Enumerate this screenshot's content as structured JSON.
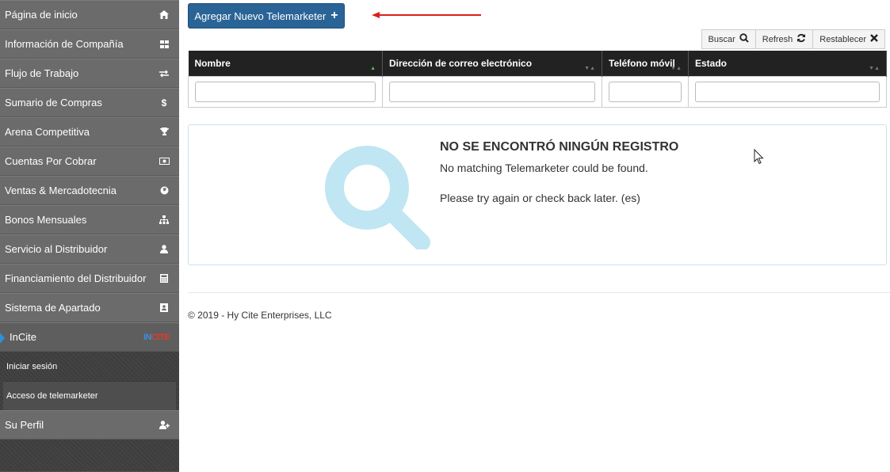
{
  "sidebar": {
    "items": [
      {
        "label": "Página de inicio",
        "icon": "home-icon"
      },
      {
        "label": "Información de Compañía",
        "icon": "grid-icon"
      },
      {
        "label": "Flujo de Trabajo",
        "icon": "exchange-icon"
      },
      {
        "label": "Sumario de Compras",
        "icon": "dollar-icon"
      },
      {
        "label": "Arena Competitiva",
        "icon": "trophy-icon"
      },
      {
        "label": "Cuentas Por Cobrar",
        "icon": "money-icon"
      },
      {
        "label": "Ventas & Mercadotecnia",
        "icon": "globe-icon"
      },
      {
        "label": "Bonos Mensuales",
        "icon": "sitemap-icon"
      },
      {
        "label": "Servicio al Distribuidor",
        "icon": "user-icon"
      },
      {
        "label": "Financiamiento del Distribuidor",
        "icon": "calculator-icon"
      },
      {
        "label": "Sistema de Apartado",
        "icon": "contact-card-icon"
      }
    ],
    "incite": {
      "label": "InCite",
      "logo_in": "IN",
      "logo_cite": "CITE"
    },
    "sub_items": [
      {
        "label": "Iniciar sesión"
      },
      {
        "label": "Acceso de telemarketer"
      }
    ],
    "profile": {
      "label": "Su Perfil",
      "icon": "user-add-icon"
    }
  },
  "main": {
    "add_button": "Agregar Nuevo Telemarketer",
    "toolbar": {
      "search": "Buscar",
      "refresh": "Refresh",
      "reset": "Restablecer"
    },
    "columns": [
      "Nombre",
      "Dirección de correo electrónico",
      "Teléfono móvil",
      "Estado"
    ],
    "empty": {
      "title": "NO SE ENCONTRÓ NINGÚN REGISTRO",
      "line1": "No matching Telemarketer could be found.",
      "line2": "Please try again or check back later. (es)"
    },
    "footer": "© 2019 - Hy Cite Enterprises, LLC"
  },
  "colors": {
    "primary": "#2a6496",
    "accent_arrow": "#d9211b",
    "sidebar": "#6b6b6b",
    "search_icon": "#bfe6f2"
  }
}
